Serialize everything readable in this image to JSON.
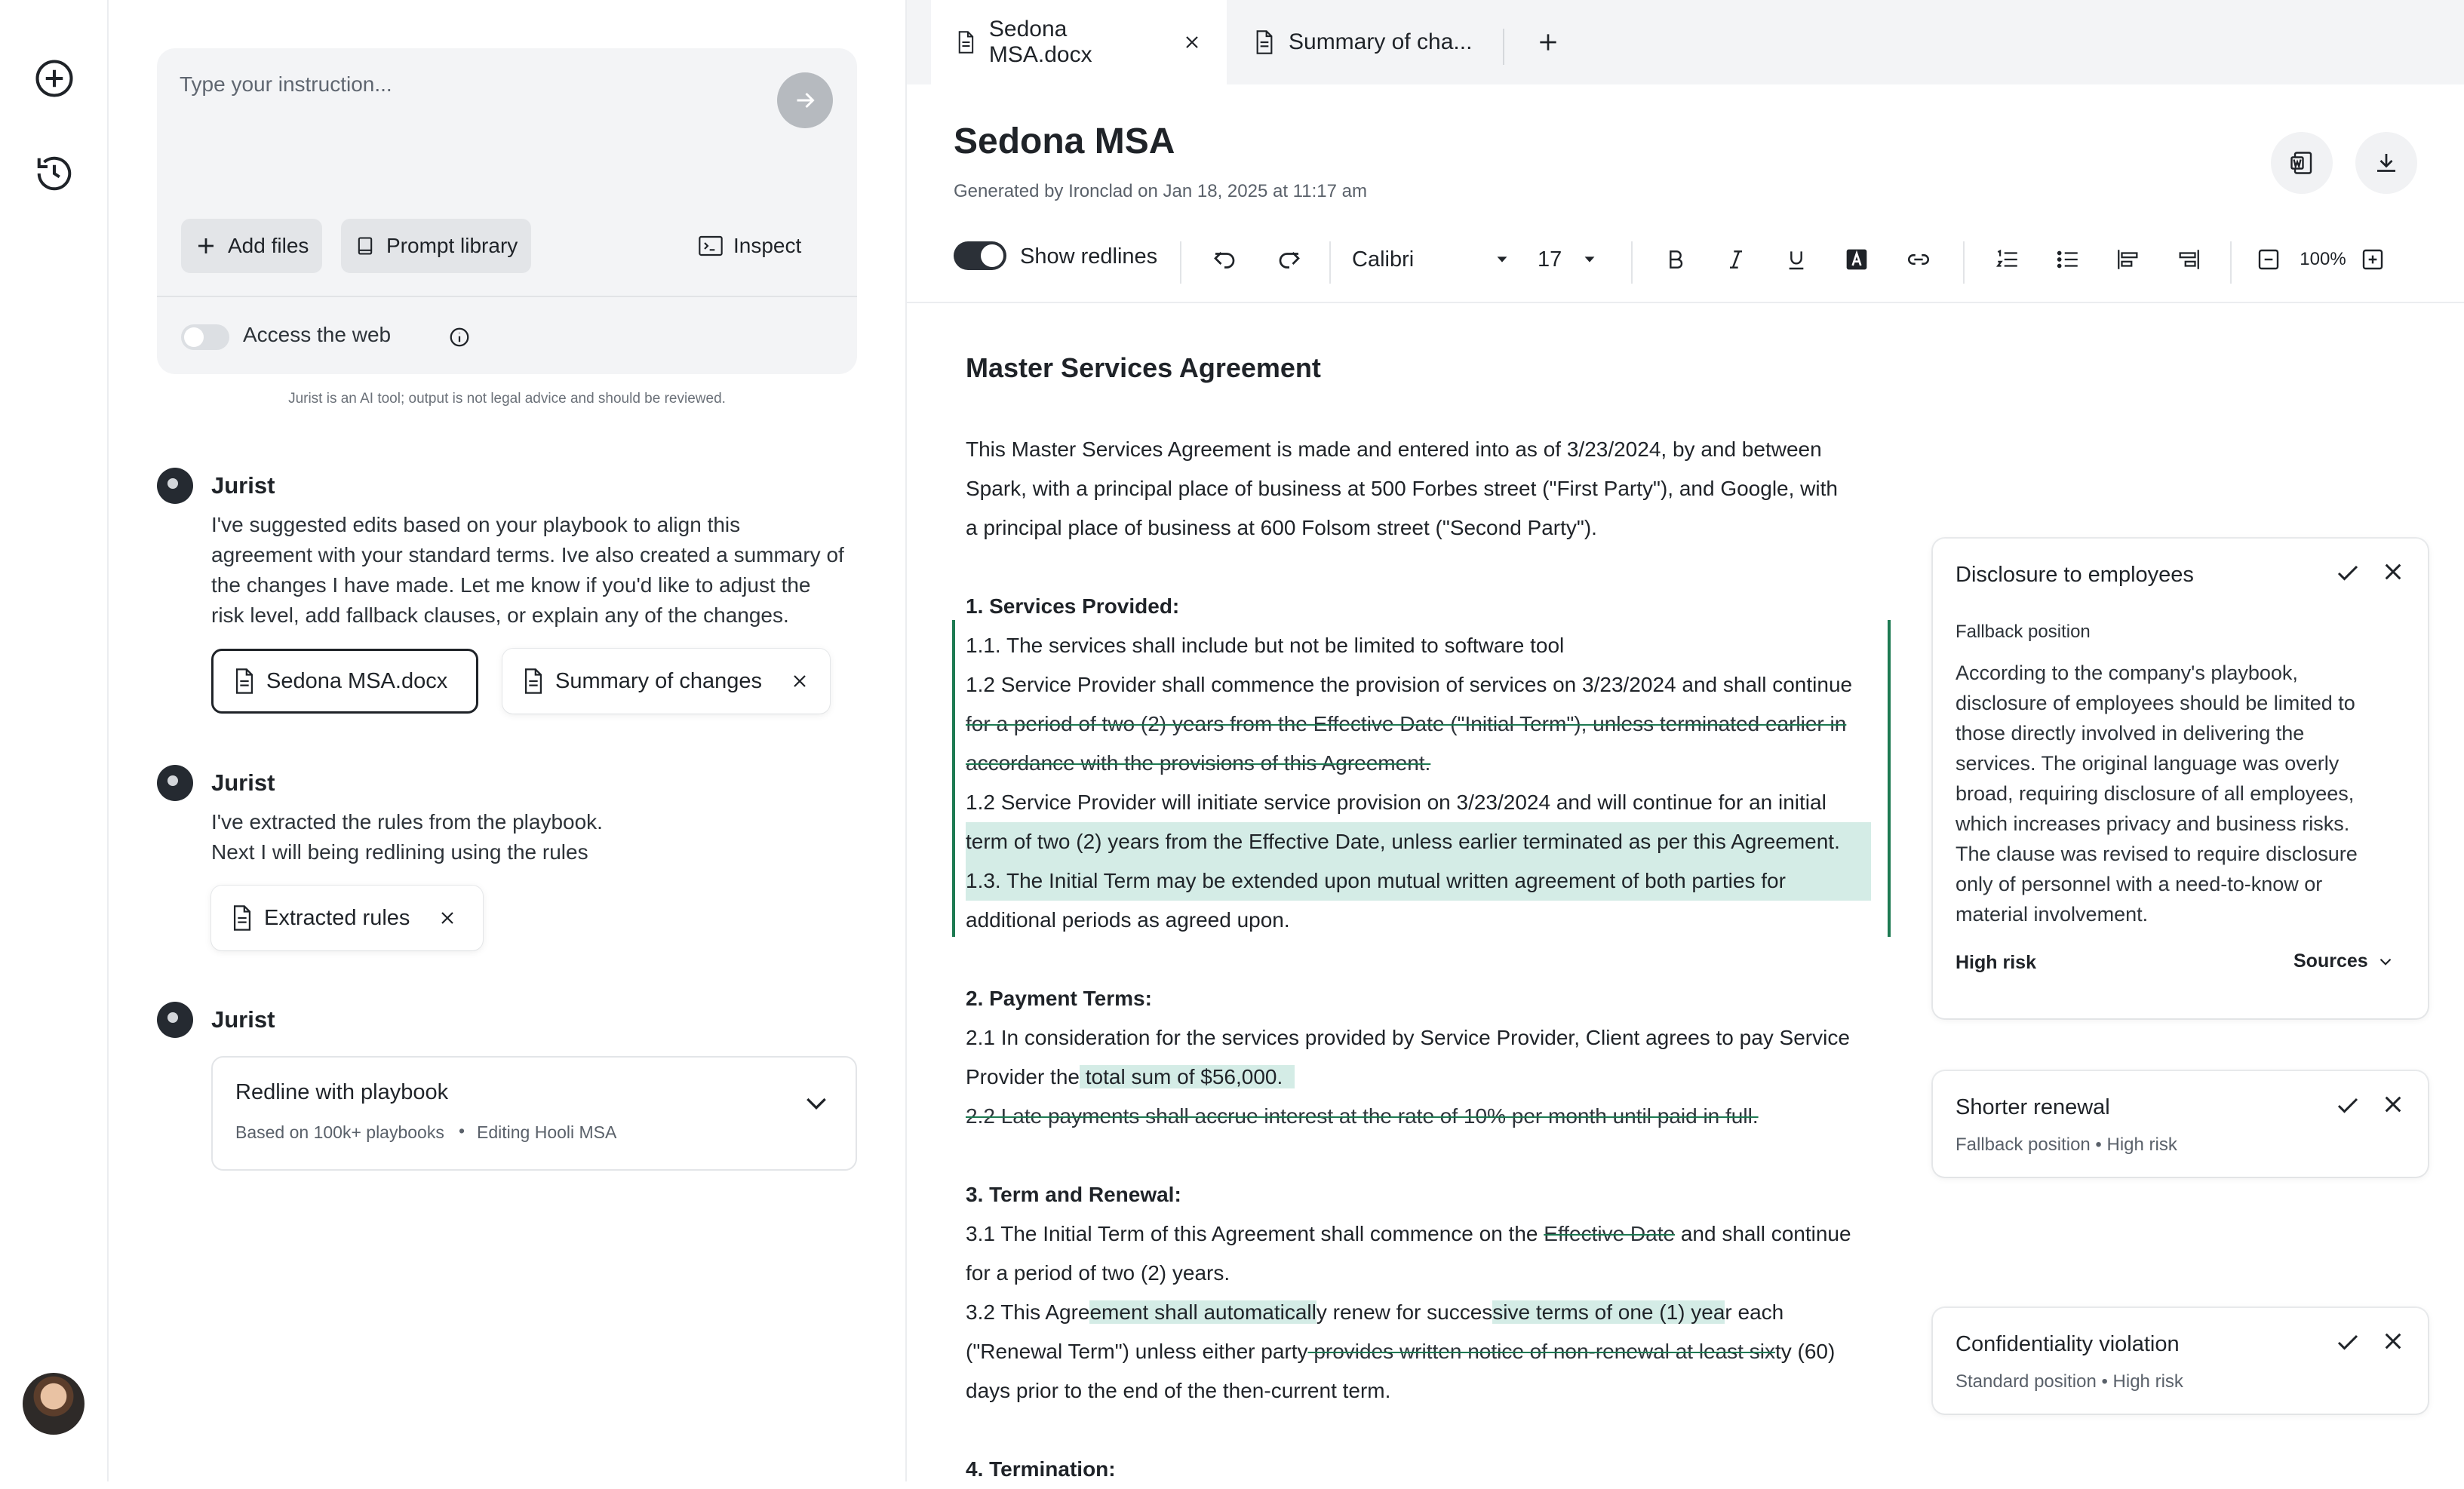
{
  "chat": {
    "instruction_placeholder": "Type your instruction...",
    "add_files": "Add files",
    "prompt_library": "Prompt library",
    "inspect": "Inspect",
    "access_web": "Access the web",
    "disclaimer": "Jurist is an AI tool; output is not legal advice and should be reviewed.",
    "messages": [
      {
        "sender": "Jurist",
        "lines": [
          "I've suggested edits based on your playbook to align this",
          "agreement with your standard terms. Ive also created a summary of",
          "the changes I have made. Let me know if you'd like to adjust the",
          "risk level, add fallback clauses, or explain any of the changes."
        ],
        "attachments": [
          "Sedona MSA.docx",
          "Summary of changes"
        ]
      },
      {
        "sender": "Jurist",
        "lines": [
          "I've extracted the rules from the playbook.",
          "Next I will being redlining using the rules"
        ],
        "attachments": [
          "Extracted rules"
        ]
      },
      {
        "sender": "Jurist",
        "card": {
          "title": "Redline with playbook",
          "sub1": "Based on 100k+ playbooks",
          "sub2": "Editing Hooli MSA"
        }
      }
    ]
  },
  "tabs": [
    {
      "label": "Sedona MSA.docx"
    },
    {
      "label": "Summary of cha..."
    }
  ],
  "document": {
    "title": "Sedona MSA",
    "subtitle": "Generated by Ironclad on Jan 18, 2025 at 11:17 am",
    "toolbar": {
      "show_redlines": "Show redlines",
      "font": "Calibri",
      "size": "17",
      "zoom": "100%"
    },
    "heading": "Master Services Agreement",
    "intro": [
      "This Master Services Agreement is made and entered into as of 3/23/2024, by and between",
      "Spark, with a principal place of business at 500 Forbes street (\"First Party\"), and Google, with",
      "a principal place of business at 600 Folsom street (\"Second Party\")."
    ],
    "s1": {
      "heading": "1. Services Provided:",
      "l1": "1.1. The services shall include but not be limited to software tool",
      "l2": "1.2 Service Provider shall commence the provision of services on 3/23/2024 and shall continue",
      "del1": "for a period of two (2) years from the Effective Date (\"Initial Term\"), unless terminated earlier in",
      "del2": "accordance with the provisions of this Agreement.",
      "l3": "1.2 Service Provider will initiate service provision on 3/23/2024 and will continue for an initial",
      "ins1": "term of two (2) years from the Effective Date, unless earlier terminated as per this Agreement.",
      "ins2": "1.3. The Initial Term may be extended upon mutual written agreement of both parties for",
      "l4": "additional periods as agreed upon."
    },
    "s2": {
      "heading": "2. Payment Terms:",
      "l1": "2.1 In consideration for the services provided by Service Provider, Client agrees to pay Service",
      "l2a": "Provider the",
      "l2b": " total sum of $56,000.",
      "del": "2.2 Late payments shall accrue interest at the rate of 10% per month until paid in full."
    },
    "s3": {
      "heading": "3. Term and Renewal:",
      "l1a": "3.1 The Initial Term of this Agreement shall commence on the ",
      "l1b": "Effective Date",
      "l1c": " and shall continue",
      "l2": "for a period of two (2) years.",
      "l3a": "3.2 This Agre",
      "l3b": "ement shall automaticall",
      "l3c": "y renew for succes",
      "l3d": "sive terms of one (1) yea",
      "l3e": "r each",
      "l4a": "(\"Renewal Term\") unless either party",
      "l4b": " provides written notice of non-renewal at least six",
      "l4c": "ty (60)",
      "l5": "days prior to the end of the then-current term."
    },
    "s4": {
      "heading": "4. Termination:"
    }
  },
  "comments": [
    {
      "title": "Disclosure to employees",
      "label": "Fallback position",
      "body": [
        "According to the company's playbook,",
        "disclosure of employees should be limited to",
        "those directly involved in delivering the",
        "services. The original language was overly",
        "broad, requiring disclosure of all employees,",
        "which increases privacy and business risks.",
        "The clause was revised to require disclosure",
        "only of personnel with a need-to-know or",
        "material involvement."
      ],
      "risk": "High risk",
      "sources": "Sources"
    },
    {
      "title": "Shorter renewal",
      "meta1": "Fallback position",
      "meta2": "High risk"
    },
    {
      "title": "Confidentiality violation",
      "meta1": "Standard position",
      "meta2": "High risk"
    }
  ],
  "colors": {
    "accent_green": "#1d7a52",
    "insert_highlight": "#d4ece6",
    "dark": "#1f2328"
  }
}
